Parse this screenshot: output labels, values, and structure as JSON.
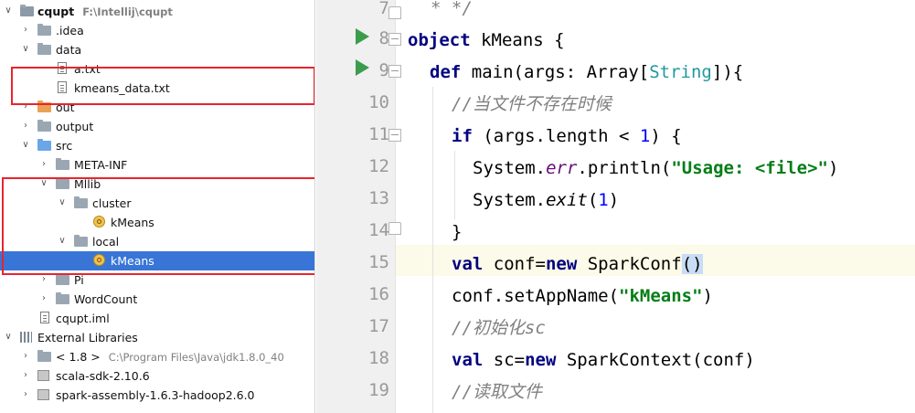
{
  "project_tree": {
    "rows": [
      {
        "name": "cqupt",
        "path": "F:\\Intellij\\cqupt"
      },
      {
        "name": ".idea"
      },
      {
        "name": "data"
      },
      {
        "name": "a.txt"
      },
      {
        "name": "kmeans_data.txt"
      },
      {
        "name": "out"
      },
      {
        "name": "output"
      },
      {
        "name": "src"
      },
      {
        "name": "META-INF"
      },
      {
        "name": "Mllib"
      },
      {
        "name": "cluster"
      },
      {
        "name": "kMeans"
      },
      {
        "name": "local"
      },
      {
        "name": "kMeans"
      },
      {
        "name": "Pi"
      },
      {
        "name": "WordCount"
      },
      {
        "name": "cqupt.iml"
      },
      {
        "name": "External Libraries"
      },
      {
        "name": "< 1.8 >",
        "path": "C:\\Program Files\\Java\\jdk1.8.0_40"
      },
      {
        "name": "scala-sdk-2.10.6"
      },
      {
        "name": "spark-assembly-1.6.3-hadoop2.6.0"
      }
    ],
    "selected_row": 13
  },
  "editor": {
    "line_numbers": [
      "7",
      "8",
      "9",
      "10",
      "11",
      "12",
      "13",
      "14",
      "15",
      "16",
      "17",
      "18",
      "19"
    ],
    "tokens": {
      "l7": "* */",
      "l8_kw": "object",
      "l8_rest": " kMeans {",
      "l9_kw": "def",
      "l9_a": " main(args: Array[",
      "l9_type": "String",
      "l9_b": "]){",
      "l10": "//当文件不存在时候",
      "l11_kw": "if",
      "l11_a": " (args.length < ",
      "l11_num": "1",
      "l11_b": ") {",
      "l12_a": "System.",
      "l12_err": "err",
      "l12_b": ".println(",
      "l12_str": "\"Usage: <file>\"",
      "l12_c": ")",
      "l13_a": "System.",
      "l13_exit": "exit",
      "l13_b": "(",
      "l13_num": "1",
      "l13_c": ")",
      "l14": "}",
      "l15_kw": "val",
      "l15_a": " conf=",
      "l15_kw2": "new",
      "l15_b": " SparkConf",
      "l15_paren": "()",
      "l16_a": "conf.setAppName(",
      "l16_str": "\"kMeans\"",
      "l16_b": ")",
      "l17": "//初始化sc",
      "l18_kw": "val",
      "l18_a": " sc=",
      "l18_kw2": "new",
      "l18_b": " SparkContext(conf)",
      "l19": "//读取文件"
    }
  },
  "colors": {
    "selection": "#3875d7",
    "highlight_box": "#e8242e",
    "keyword": "#000080",
    "string": "#067d17"
  }
}
